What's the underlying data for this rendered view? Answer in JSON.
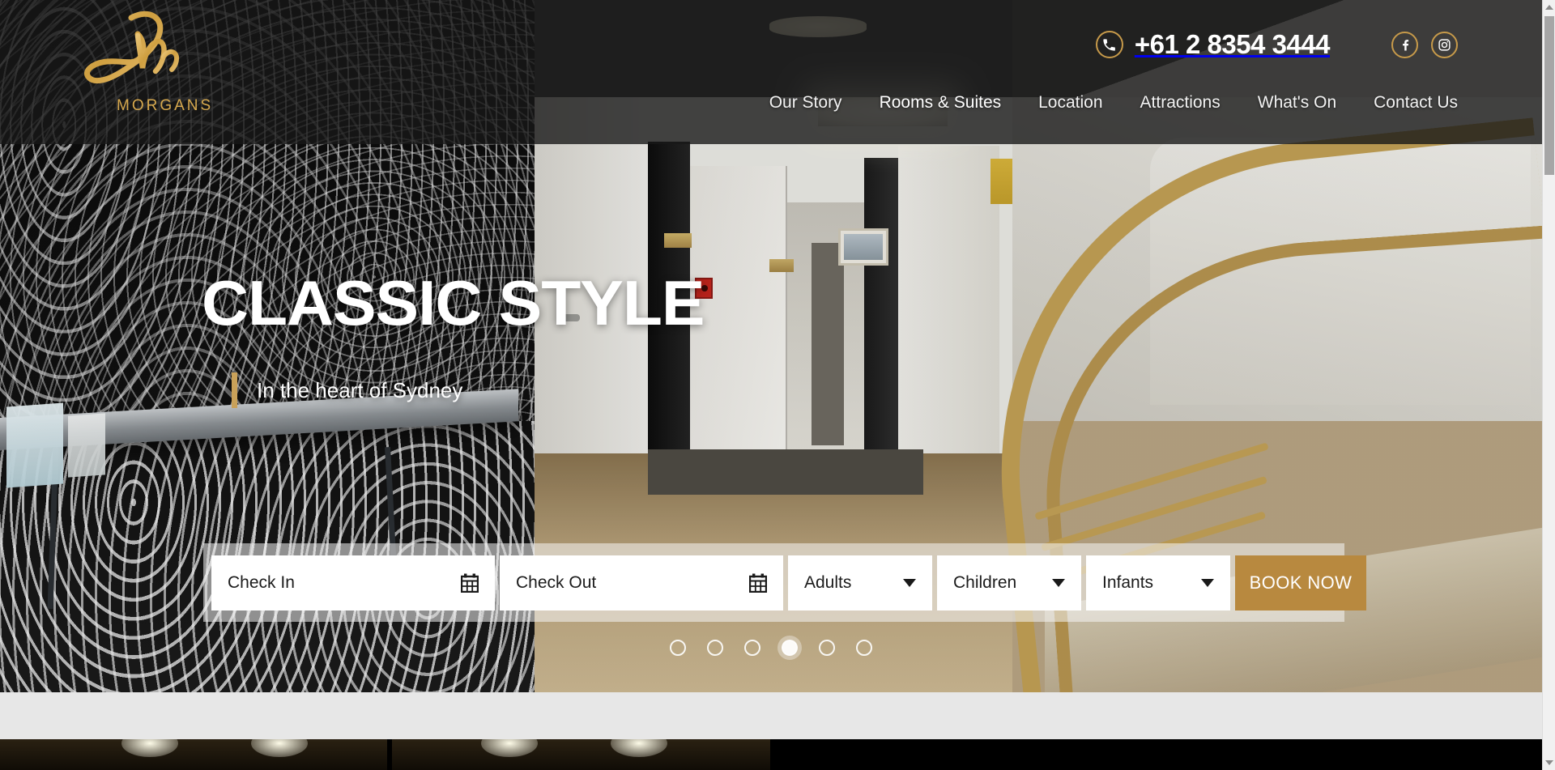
{
  "site": {
    "logo_mark": "morgans-script-m",
    "logo_text": "MORGANS"
  },
  "header": {
    "phone": {
      "icon": "phone-icon",
      "number": "+61 2 8354 3444"
    },
    "social": [
      {
        "name": "facebook",
        "icon": "facebook-icon",
        "glyph": "f"
      },
      {
        "name": "instagram",
        "icon": "instagram-icon",
        "glyph": "▢"
      }
    ],
    "nav": [
      {
        "label": "Our Story",
        "active": false
      },
      {
        "label": "Rooms & Suites",
        "active": true
      },
      {
        "label": "Location",
        "active": false
      },
      {
        "label": "Attractions",
        "active": false
      },
      {
        "label": "What's On",
        "active": false
      },
      {
        "label": "Contact Us",
        "active": false
      }
    ]
  },
  "hero": {
    "title": "CLASSIC STYLE",
    "subtitle": "In the heart of Sydney",
    "accent_color": "#c9a159"
  },
  "booking": {
    "check_in": {
      "label": "Check In",
      "placeholder": "Check In",
      "value": "",
      "icon": "calendar-icon"
    },
    "check_out": {
      "label": "Check Out",
      "placeholder": "Check Out",
      "value": "",
      "icon": "calendar-icon"
    },
    "adults": {
      "label": "Adults",
      "icon": "chevron-down-icon"
    },
    "children": {
      "label": "Children",
      "icon": "chevron-down-icon"
    },
    "infants": {
      "label": "Infants",
      "icon": "chevron-down-icon"
    },
    "book_button": {
      "label": "BOOK NOW",
      "color": "#b8893f"
    }
  },
  "slider": {
    "total": 6,
    "active_index": 4,
    "dots": [
      {
        "index": 1,
        "active": false
      },
      {
        "index": 2,
        "active": false
      },
      {
        "index": 3,
        "active": false
      },
      {
        "index": 4,
        "active": true
      },
      {
        "index": 5,
        "active": false
      },
      {
        "index": 6,
        "active": false
      }
    ]
  },
  "colors": {
    "gold": "#c79a4a",
    "logo_gold": "#d7a94e",
    "button_tan": "#b8893f",
    "header_overlay": "rgba(26,26,26,0.72)",
    "gray_band": "#e7e7e7"
  }
}
